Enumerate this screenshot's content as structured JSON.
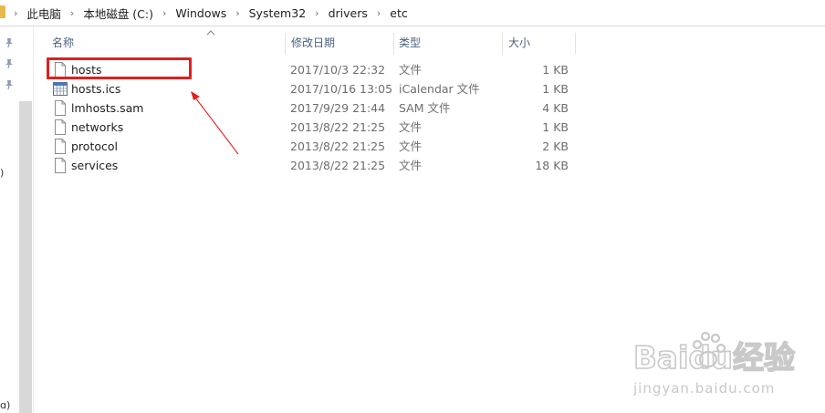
{
  "breadcrumb": [
    "此电脑",
    "本地磁盘 (C:)",
    "Windows",
    "System32",
    "drivers",
    "etc"
  ],
  "nav": {
    "edge_text_1": ")",
    "edge_text_2": "ɑ)"
  },
  "columns": {
    "name": "名称",
    "date": "修改日期",
    "type": "类型",
    "size": "大小"
  },
  "files": [
    {
      "name": "hosts",
      "date": "2017/10/3 22:32",
      "type": "文件",
      "size": "1 KB",
      "icon": "file-icon"
    },
    {
      "name": "hosts.ics",
      "date": "2017/10/16 13:05",
      "type": "iCalendar 文件",
      "size": "1 KB",
      "icon": "calendar-file-icon"
    },
    {
      "name": "lmhosts.sam",
      "date": "2017/9/29 21:44",
      "type": "SAM 文件",
      "size": "4 KB",
      "icon": "file-icon"
    },
    {
      "name": "networks",
      "date": "2013/8/22 21:25",
      "type": "文件",
      "size": "1 KB",
      "icon": "file-icon"
    },
    {
      "name": "protocol",
      "date": "2013/8/22 21:25",
      "type": "文件",
      "size": "2 KB",
      "icon": "file-icon"
    },
    {
      "name": "services",
      "date": "2013/8/22 21:25",
      "type": "文件",
      "size": "18 KB",
      "icon": "file-icon"
    }
  ],
  "watermark": {
    "brand": "Baidu经验",
    "url": "jingyan.baidu.com"
  },
  "colors": {
    "highlight": "#e21f1f",
    "header_text": "#4d6082",
    "accent_blue": "#3366cc"
  }
}
